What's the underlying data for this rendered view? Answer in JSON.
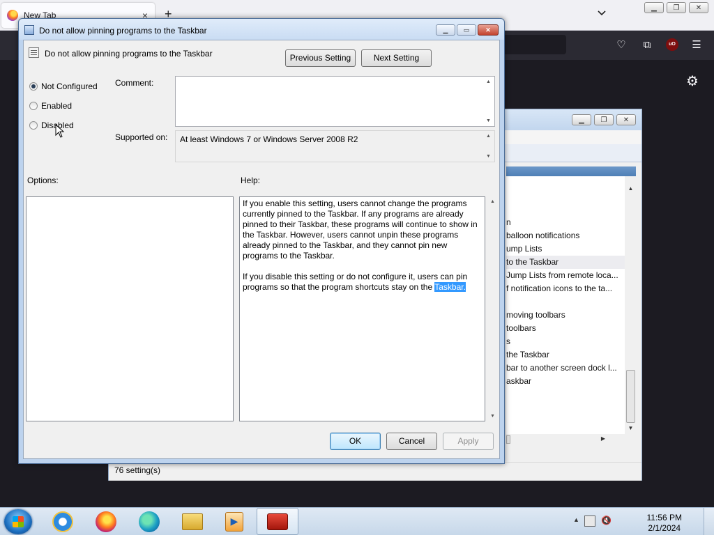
{
  "firefox": {
    "tab_title": "New Tab",
    "tab_close": "×",
    "new_tab": "+",
    "back": "←"
  },
  "gpe": {
    "status": "76 setting(s)",
    "rows": [
      "",
      "",
      "",
      "n",
      "balloon notifications",
      "ump Lists",
      "to the Taskbar",
      "Jump Lists from remote loca...",
      "f notification icons to the ta...",
      "",
      "moving toolbars",
      "toolbars",
      "s",
      "the Taskbar",
      "bar to another screen dock l...",
      "askbar"
    ],
    "selected_row": 6
  },
  "dialog": {
    "title": "Do not allow pinning programs to the Taskbar",
    "policy_name": "Do not allow pinning programs to the Taskbar",
    "previous_setting": "Previous Setting",
    "next_setting": "Next Setting",
    "radio_not_configured": "Not Configured",
    "radio_enabled": "Enabled",
    "radio_disabled": "Disabled",
    "selected_option": "Not Configured",
    "comment_label": "Comment:",
    "comment_value": "",
    "supported_label": "Supported on:",
    "supported_value": "At least Windows 7 or Windows Server 2008 R2",
    "options_label": "Options:",
    "help_label": "Help:",
    "help_p1": "If you enable this setting, users cannot change the programs currently pinned to the Taskbar. If any programs are already pinned to their Taskbar, these programs will continue to show in the Taskbar. However, users cannot unpin these programs already pinned to the Taskbar, and they cannot pin new programs to the Taskbar.",
    "help_p2_pre": "If you disable this setting or do not configure it, users can pin programs so that the program shortcuts stay on the ",
    "help_p2_highlight": "Taskbar.",
    "ok": "OK",
    "cancel": "Cancel",
    "apply": "Apply"
  },
  "taskbar": {
    "time": "11:56 PM",
    "date": "2/1/2024",
    "apps": [
      "internet-explorer",
      "firefox",
      "edge",
      "file-explorer",
      "media-player",
      "toolbox"
    ],
    "active_app": "toolbox"
  },
  "colors": {
    "highlight": "#3399ff",
    "firefox_toolbar": "#2b2a33",
    "dialog_frame": "#bdd3ee"
  }
}
